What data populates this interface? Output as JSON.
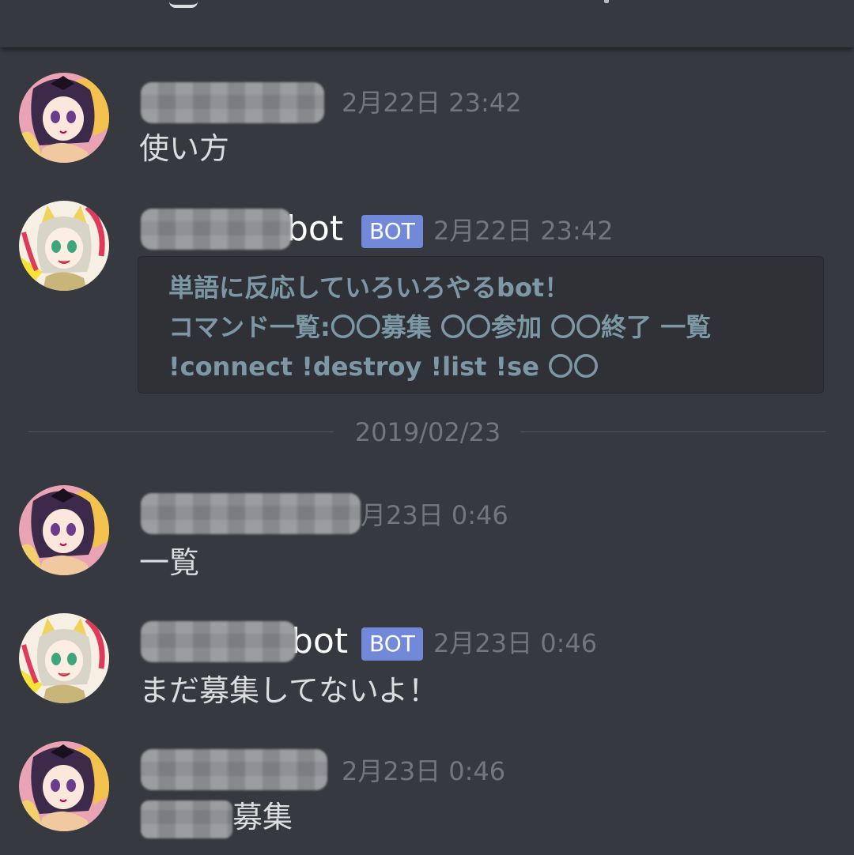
{
  "messages": [
    {
      "author_visible_part": "",
      "timestamp": "2月22日 23:42",
      "content": "使い方",
      "avatar_icon": "girl-dark-hair-avatar-icon"
    },
    {
      "author_visible_part": "bot",
      "badge": "BOT",
      "timestamp": "2月22日 23:42",
      "avatar_icon": "girl-cat-ears-avatar-icon",
      "embed": {
        "lines": [
          "単語に反応していろいろやるbot！",
          "コマンド一覧:〇〇募集 〇〇参加 〇〇終了 一覧",
          "!connect !destroy !list !se 〇〇"
        ]
      }
    }
  ],
  "date_divider": "2019/02/23",
  "messages_after": [
    {
      "author_visible_part": "",
      "timestamp": "月23日 0:46",
      "content": "一覧",
      "avatar_icon": "girl-dark-hair-avatar-icon"
    },
    {
      "author_visible_part": "bot",
      "badge": "BOT",
      "timestamp": "2月23日 0:46",
      "content": "まだ募集してないよ！",
      "avatar_icon": "girl-cat-ears-avatar-icon"
    },
    {
      "author_visible_part": "",
      "timestamp": "2月23日 0:46",
      "content": "募集",
      "avatar_icon": "girl-dark-hair-avatar-icon"
    }
  ],
  "colors": {
    "background": "#36393f",
    "bot_badge": "#7289da",
    "timestamp": "#72767d",
    "embed_background": "#2f3136",
    "embed_text": "#7c98a4"
  }
}
